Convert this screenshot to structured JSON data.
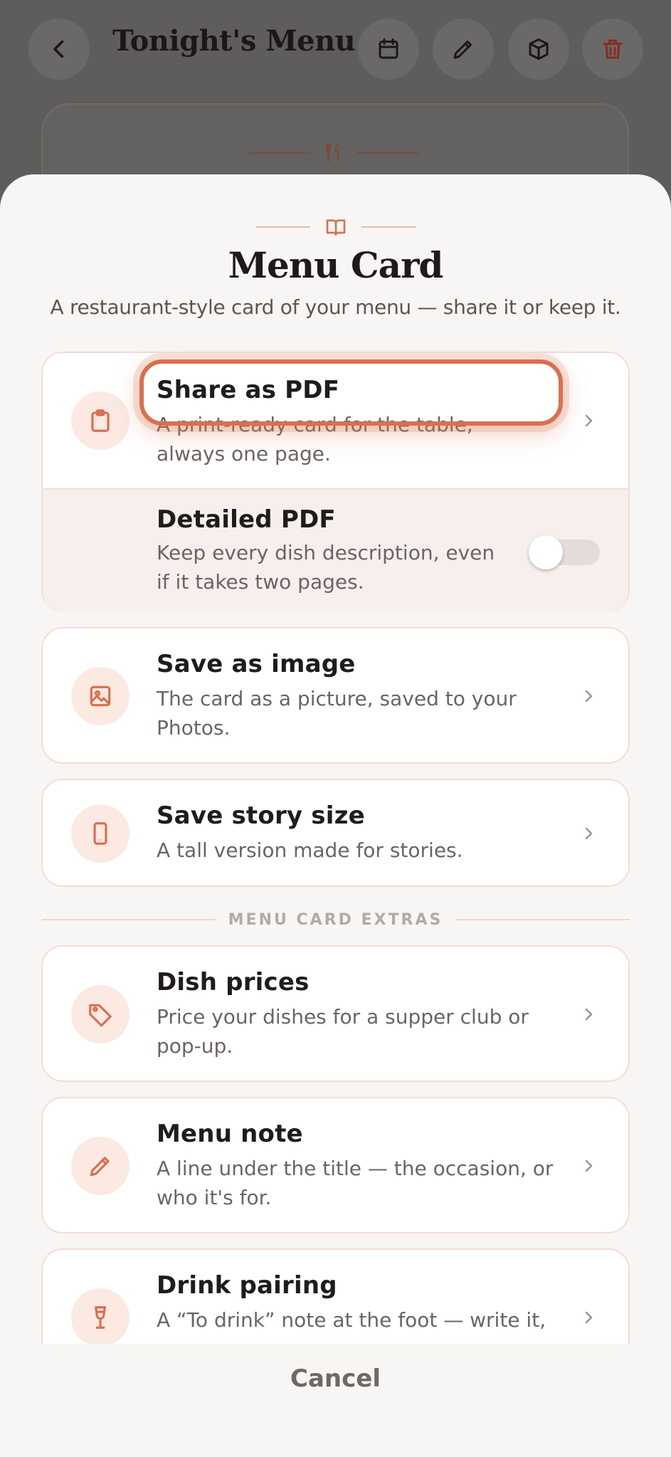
{
  "background": {
    "title": "Tonight's Menu",
    "icons": [
      "back-icon",
      "calendar-icon",
      "pencil-icon",
      "box-icon",
      "trash-icon"
    ]
  },
  "sheet": {
    "title": "Menu Card",
    "subtitle": "A restaurant-style card of your menu — share it or keep it.",
    "share_pdf": {
      "title": "Share as PDF",
      "desc": "A print-ready card for the table, always one page.",
      "icon": "clipboard-icon"
    },
    "detailed_pdf": {
      "title": "Detailed PDF",
      "desc": "Keep every dish description, even if it takes two pages.",
      "enabled": false
    },
    "save_image": {
      "title": "Save as image",
      "desc": "The card as a picture, saved to your Photos.",
      "icon": "image-icon"
    },
    "save_story": {
      "title": "Save story size",
      "desc": "A tall version made for stories.",
      "icon": "phone-icon"
    },
    "extras_header": "MENU CARD EXTRAS",
    "dish_prices": {
      "title": "Dish prices",
      "desc": "Price your dishes for a supper club or pop-up.",
      "icon": "tag-icon"
    },
    "menu_note": {
      "title": "Menu note",
      "desc": "A line under the title — the occasion, or who it's for.",
      "icon": "pencil-icon"
    },
    "drink_pairing": {
      "title": "Drink pairing",
      "desc": "A “To drink” note at the foot — write it,",
      "icon": "wine-glass-icon"
    },
    "cancel_label": "Cancel"
  },
  "colors": {
    "accent": "#d9704f",
    "icon_bg": "#fbe9e2",
    "sheet_bg": "#f8f6f4"
  }
}
